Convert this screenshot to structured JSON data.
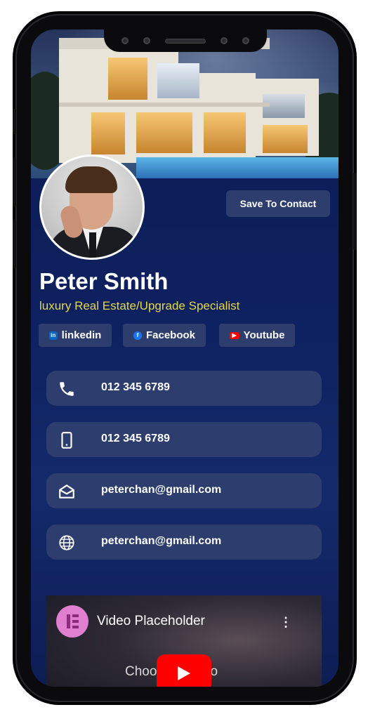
{
  "profile": {
    "name": "Peter Smith",
    "subtitle": "luxury Real Estate/Upgrade Specialist",
    "save_label": "Save To Contact"
  },
  "social": [
    {
      "label": "linkedin",
      "icon": "linkedin-icon",
      "color": "#0a66c2"
    },
    {
      "label": "Facebook",
      "icon": "facebook-icon",
      "color": "#1877f2"
    },
    {
      "label": "Youtube",
      "icon": "youtube-icon",
      "color": "#ff0000"
    }
  ],
  "contacts": [
    {
      "icon": "phone-icon",
      "text": "012 345 6789"
    },
    {
      "icon": "mobile-icon",
      "text": "012 345 6789"
    },
    {
      "icon": "envelope-icon",
      "text": "peterchan@gmail.com"
    },
    {
      "icon": "globe-icon",
      "text": "peterchan@gmail.com"
    }
  ],
  "video": {
    "title": "Video Placeholder",
    "subtitle": "Choose a video"
  },
  "colors": {
    "background": "#0e2160",
    "button": "#2d3e6e",
    "accent_text": "#e6d84a"
  }
}
